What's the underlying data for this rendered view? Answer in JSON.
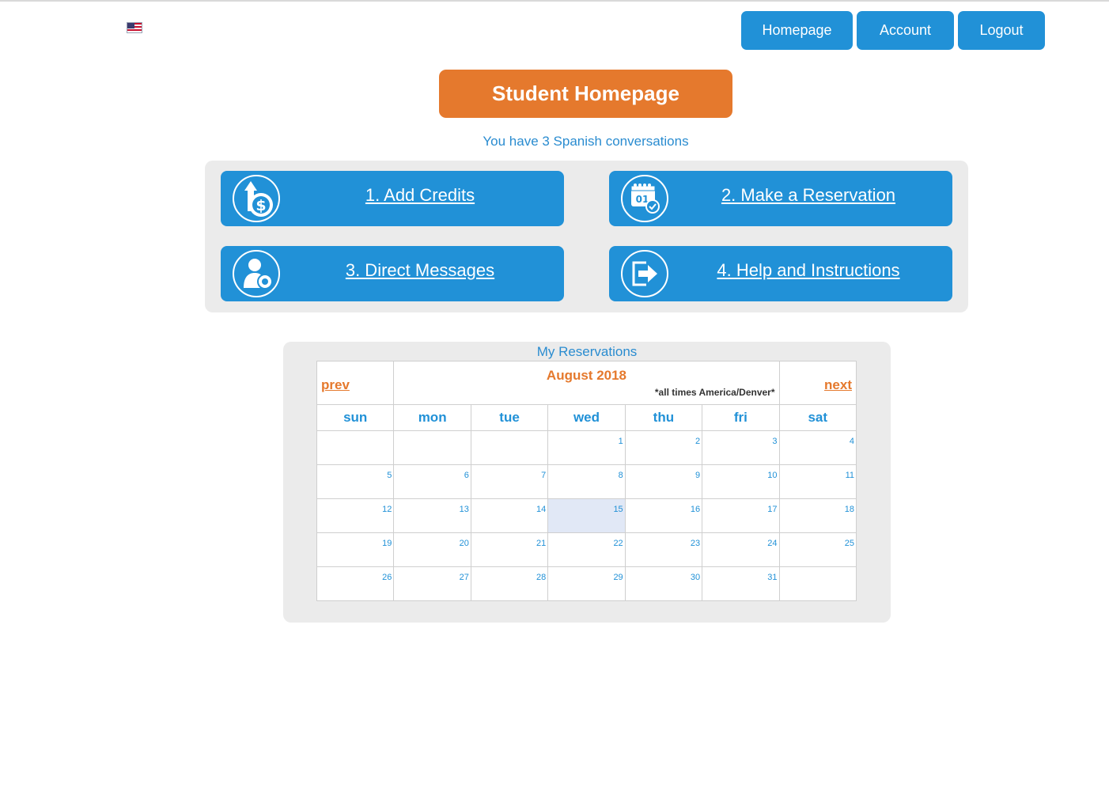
{
  "nav": {
    "homepage": "Homepage",
    "account": "Account",
    "logout": "Logout"
  },
  "page": {
    "title": "Student Homepage",
    "subtitle": "You have 3 Spanish conversations"
  },
  "actions": {
    "add_credits": "1. Add Credits",
    "make_reservation": "2. Make a Reservation",
    "direct_messages": "3. Direct Messages",
    "help": "4. Help and Instructions",
    "calendar_icon_text": "01"
  },
  "reservations": {
    "title": "My Reservations",
    "prev": "prev",
    "next": "next",
    "month": "August 2018",
    "timezone_note": "*all times America/Denver*",
    "days_of_week": [
      "sun",
      "mon",
      "tue",
      "wed",
      "thu",
      "fri",
      "sat"
    ],
    "weeks": [
      [
        "",
        "",
        "",
        "1",
        "2",
        "3",
        "4"
      ],
      [
        "5",
        "6",
        "7",
        "8",
        "9",
        "10",
        "11"
      ],
      [
        "12",
        "13",
        "14",
        "15",
        "16",
        "17",
        "18"
      ],
      [
        "19",
        "20",
        "21",
        "22",
        "23",
        "24",
        "25"
      ],
      [
        "26",
        "27",
        "28",
        "29",
        "30",
        "31",
        ""
      ]
    ],
    "highlighted_day": "15"
  },
  "colors": {
    "brand_blue": "#2191d7",
    "brand_orange": "#e5792d",
    "panel_gray": "#ebebeb",
    "today_highlight": "#e1e8f6"
  }
}
